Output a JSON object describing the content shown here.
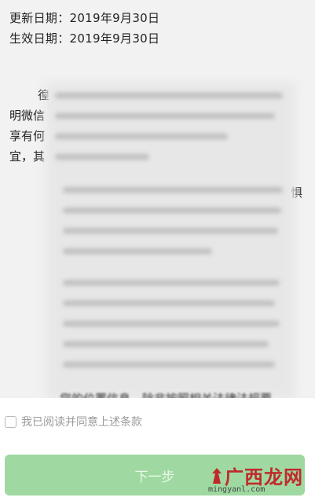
{
  "dates": {
    "updated": "更新日期：2019年9月30日",
    "effective": "生效日期：2019年9月30日"
  },
  "agreement": {
    "visible_fragments": [
      "徨",
      "明微信",
      "享有何",
      "宜，其",
      "惧"
    ],
    "bottom_line": "您的位置信息，除非按照相关法律法规要"
  },
  "footer": {
    "agree_label": "我已阅读并同意上述条款",
    "agree_checked": false,
    "next_button": "下一步"
  },
  "watermark": {
    "logo_text": "广西龙网",
    "domain": "mingyanl.com"
  },
  "colors": {
    "button_bg": "#9fd9a1",
    "watermark_red": "#c0292b"
  }
}
